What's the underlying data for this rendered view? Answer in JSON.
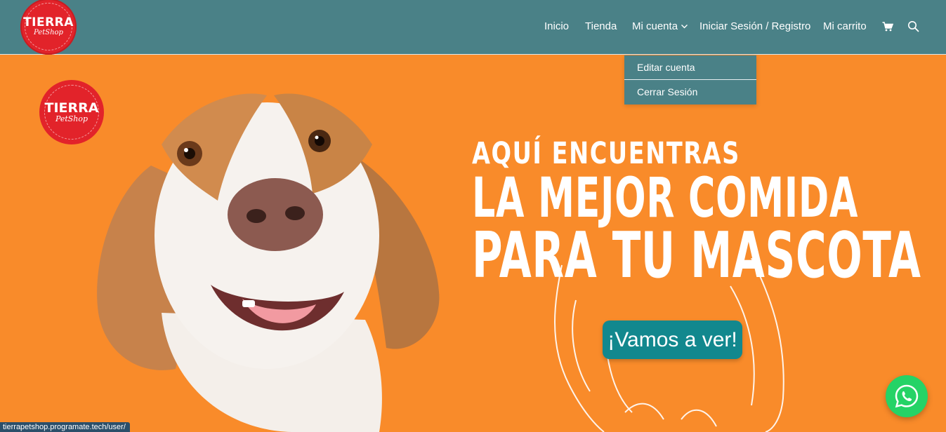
{
  "brand": {
    "logo_line1": "TIERRA",
    "logo_line2": "PetShop"
  },
  "nav": {
    "items": [
      "Inicio",
      "Tienda",
      "Mi cuenta",
      "Iniciar Sesión / Registro",
      "Mi carrito"
    ],
    "icons": [
      "chevron-down-icon",
      "cart-icon",
      "search-icon"
    ]
  },
  "dropdown": {
    "items": [
      "Editar cuenta",
      "Cerrar Sesión"
    ]
  },
  "hero": {
    "logo_line1": "TIERRA",
    "logo_line2": "PetShop",
    "line1": "AQUÍ ENCUENTRAS",
    "line2": "LA MEJOR COMIDA",
    "line3": "PARA TU MASCOTA",
    "cta": "¡Vamos a ver!"
  },
  "status_url": "tierrapetshop.programate.tech/user/",
  "colors": {
    "header": "#4A8187",
    "hero_bg": "#F98B2A",
    "cta": "#12888E",
    "logo_red": "#E2232A",
    "whatsapp": "#25D366"
  }
}
